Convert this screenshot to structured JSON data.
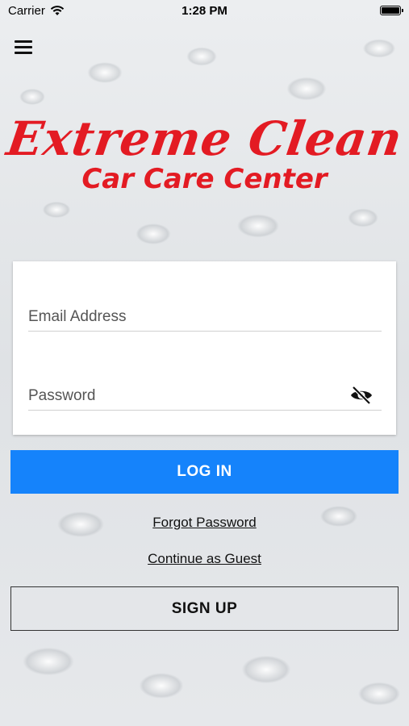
{
  "status_bar": {
    "carrier": "Carrier",
    "time": "1:28 PM"
  },
  "logo": {
    "line1": "Extreme Clean",
    "line2": "Car Care Center",
    "color": "#e31b23"
  },
  "login_form": {
    "email_placeholder": "Email Address",
    "email_value": "",
    "password_placeholder": "Password",
    "password_value": ""
  },
  "actions": {
    "login_label": "LOG IN",
    "forgot_password_label": "Forgot Password",
    "continue_guest_label": "Continue as Guest",
    "signup_label": "SIGN UP",
    "primary_color": "#1583fb"
  },
  "icons": {
    "menu": "hamburger-menu-icon",
    "password_toggle": "eye-slash-icon",
    "wifi": "wifi-icon",
    "battery": "battery-icon"
  }
}
